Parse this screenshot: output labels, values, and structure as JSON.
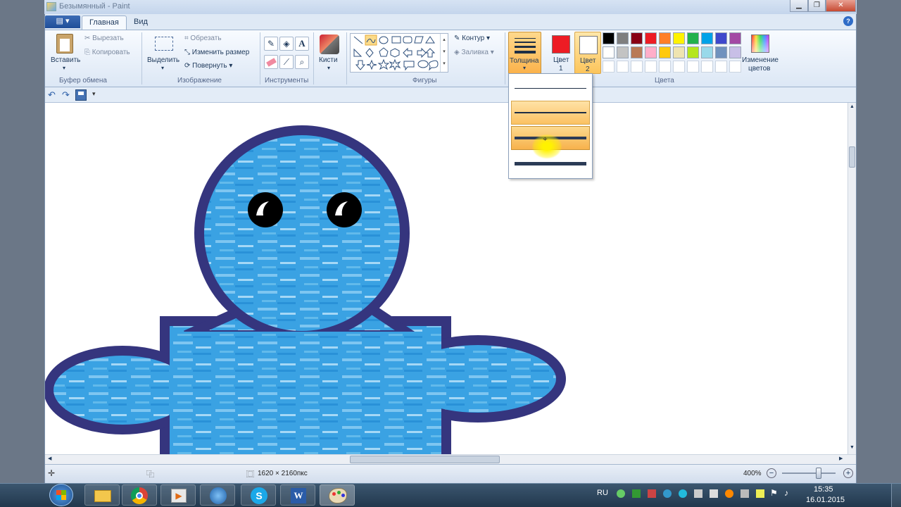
{
  "window": {
    "title": "Безымянный - Paint"
  },
  "tabs": {
    "app_menu": "▤ ▾",
    "home": "Главная",
    "view": "Вид",
    "help": "?"
  },
  "ribbon": {
    "clipboard": {
      "paste": "Вставить",
      "cut": "Вырезать",
      "copy": "Копировать",
      "group": "Буфер обмена"
    },
    "image": {
      "select": "Выделить",
      "crop": "Обрезать",
      "resize": "Изменить размер",
      "rotate": "Повернуть",
      "group": "Изображение"
    },
    "tools": {
      "group": "Инструменты"
    },
    "brushes": {
      "label": "Кисти"
    },
    "shapes": {
      "outline": "Контур",
      "fill": "Заливка",
      "group": "Фигуры"
    },
    "thickness": {
      "label": "Толщина"
    },
    "color1": {
      "line1": "Цвет",
      "line2": "1"
    },
    "color2": {
      "line1": "Цвет",
      "line2": "2"
    },
    "colors": {
      "group": "Цвета",
      "edit1": "Изменение",
      "edit2": "цветов"
    },
    "palette_row1": [
      "#000000",
      "#7f7f7f",
      "#880015",
      "#ed1c24",
      "#ff7f27",
      "#fff200",
      "#22b14c",
      "#00a2e8",
      "#3f48cc",
      "#a349a4"
    ],
    "palette_row2": [
      "#ffffff",
      "#c3c3c3",
      "#b97a57",
      "#ffaec9",
      "#ffc90e",
      "#efe4b0",
      "#b5e61d",
      "#99d9ea",
      "#7092be",
      "#c8bfe7"
    ],
    "palette_empty": [
      "#ffffff",
      "#ffffff",
      "#ffffff",
      "#ffffff",
      "#ffffff",
      "#ffffff",
      "#ffffff",
      "#ffffff",
      "#ffffff",
      "#ffffff"
    ],
    "color1_value": "#ed1c24",
    "color2_value": "#ffffff"
  },
  "status": {
    "image_size": "1620 × 2160пкс",
    "zoom": "400%"
  },
  "taskbar": {
    "lang": "RU",
    "time": "15:35",
    "date": "16.01.2015"
  }
}
